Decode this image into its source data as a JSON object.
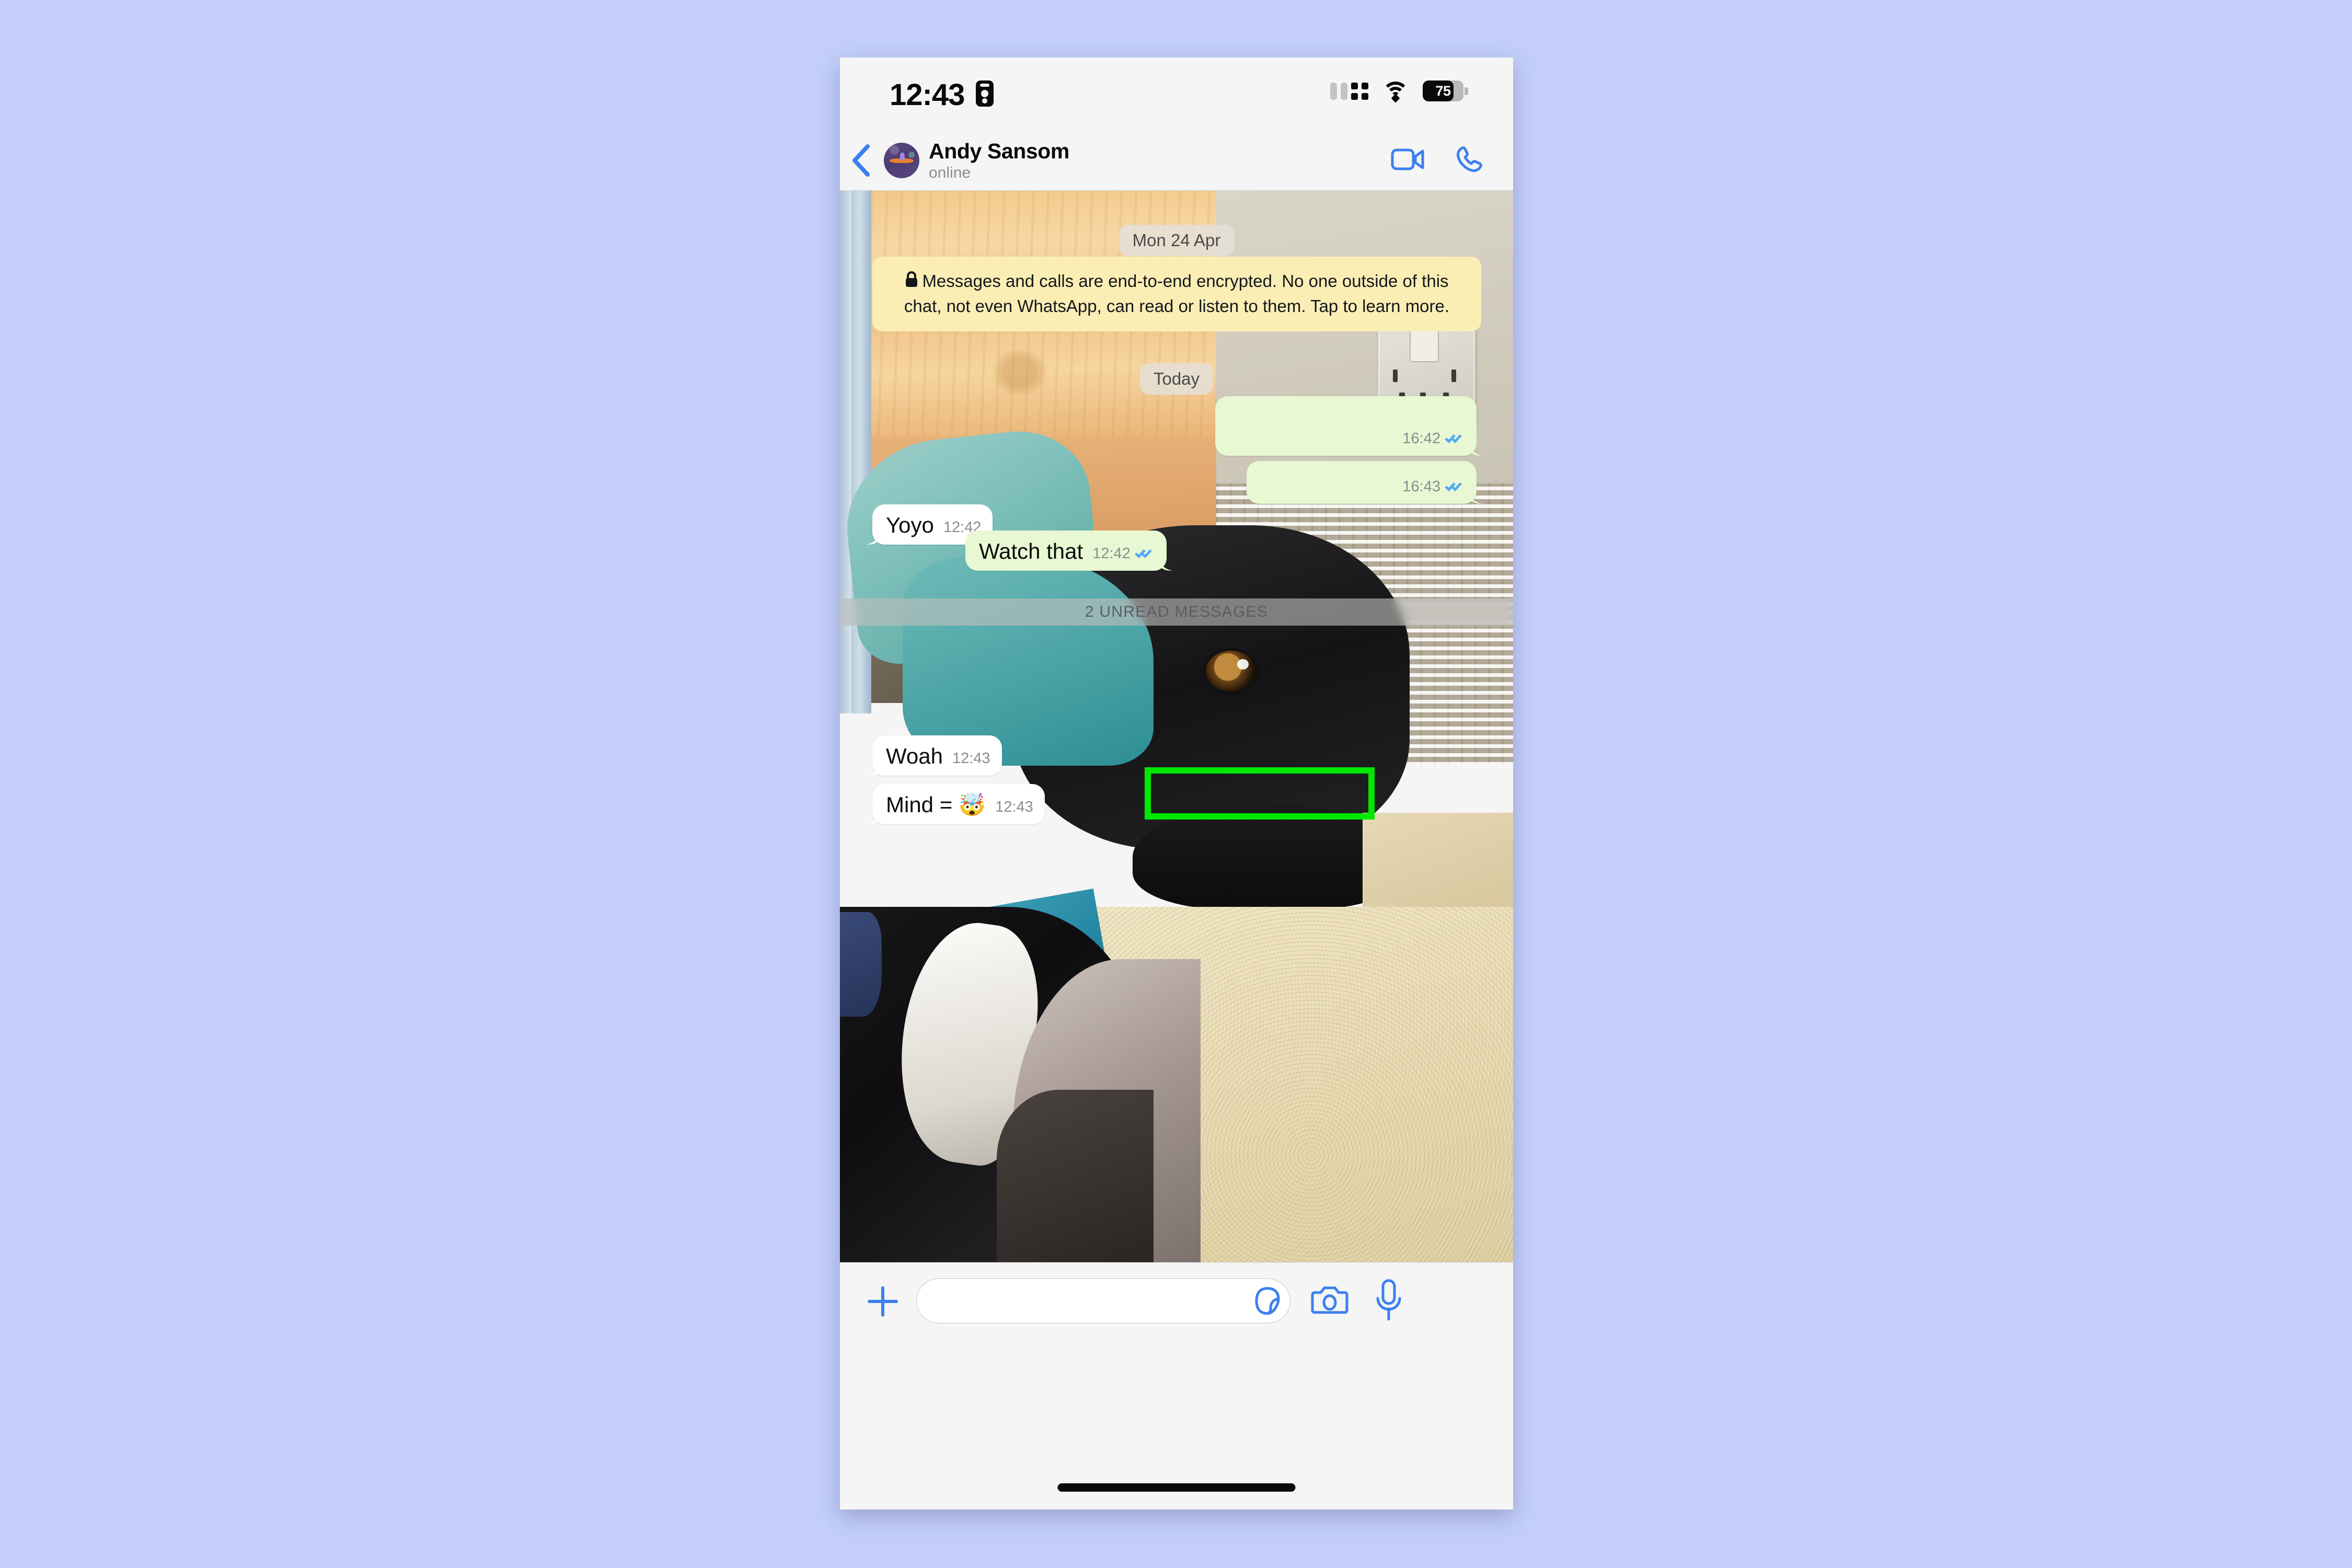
{
  "page": {
    "background_color": "#c3cffa"
  },
  "statusbar": {
    "time": "12:43",
    "recording_icon": "person-badge-icon",
    "signal_icon": "cellular-signal-icon",
    "wifi_icon": "wifi-icon",
    "battery_percent": "75",
    "battery_level": 75
  },
  "header": {
    "back_icon": "chevron-left-icon",
    "avatar_icon": "contact-avatar",
    "name": "Andy Sansom",
    "status": "online",
    "video_call_icon": "video-camera-icon",
    "voice_call_icon": "phone-icon",
    "accent_color": "#3b7ff0"
  },
  "chat": {
    "date_pill": "Mon 24 Apr",
    "today_pill": "Today",
    "encryption_notice": "Messages and calls are end-to-end encrypted. No one outside of this chat, not even WhatsApp, can read or listen to them. Tap to learn more.",
    "encryption_lock_icon": "lock-icon",
    "unread_divider": "2 UNREAD MESSAGES",
    "bubble_out_color": "#e7f8d3",
    "bubble_in_color": "#ffffff",
    "tick_color": "#53a7f5",
    "messages": [
      {
        "id": "out-1",
        "direction": "outgoing",
        "text": "",
        "time": "16:42",
        "status": "read"
      },
      {
        "id": "out-2",
        "direction": "outgoing",
        "text": "",
        "time": "16:43",
        "status": "read"
      },
      {
        "id": "yoyo",
        "direction": "incoming",
        "text": "Yoyo",
        "time": "12:42",
        "status": ""
      },
      {
        "id": "watch",
        "direction": "outgoing",
        "text": "Watch that",
        "time": "12:42",
        "status": "read"
      },
      {
        "id": "woah",
        "direction": "incoming",
        "text": "Woah",
        "time": "12:43",
        "status": ""
      },
      {
        "id": "mind",
        "direction": "incoming",
        "text": "Mind = 🤯",
        "time": "12:43",
        "status": ""
      }
    ]
  },
  "annotation": {
    "target": "watch-that-message-bubble",
    "color": "#00e800"
  },
  "composer": {
    "plus_icon": "plus-icon",
    "input_placeholder": "",
    "input_value": "",
    "sticker_icon": "sticker-icon",
    "camera_icon": "camera-icon",
    "mic_icon": "microphone-icon"
  }
}
